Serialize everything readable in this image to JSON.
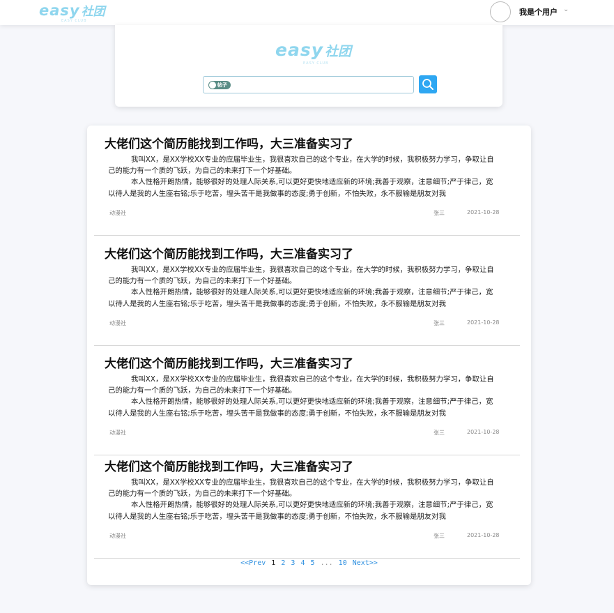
{
  "brand": {
    "logo_main": "easy",
    "logo_sub": "社团",
    "logo_tagline": "EASY CLUB"
  },
  "header": {
    "username": "我是个用户",
    "caret": "⌄"
  },
  "search": {
    "toggle_label": "帖子",
    "placeholder": ""
  },
  "posts": [
    {
      "title": "大佬们这个简历能找到工作吗，大三准备实习了",
      "body": [
        "我叫XX，是XX学校XX专业的应届毕业生，我很喜欢自己的这个专业，在大学的时候，我积极努力学习，争取让自己的能力有一个质的飞跃，为自己的未来打下一个好基础。",
        "本人性格开朗热情，能够很好的处理人际关系,可以更好更快地适应新的环境;我善于观察，注意细节;严于律己，宽以待人是我的人生座右铭;乐于吃苦，埋头苦干是我做事的态度;勇于创新，不怕失败，永不服输是朋友对我"
      ],
      "club": "动漫社",
      "author": "张三",
      "date": "2021-10-28"
    },
    {
      "title": "大佬们这个简历能找到工作吗，大三准备实习了",
      "body": [
        "我叫XX，是XX学校XX专业的应届毕业生，我很喜欢自己的这个专业，在大学的时候，我积极努力学习，争取让自己的能力有一个质的飞跃，为自己的未来打下一个好基础。",
        "本人性格开朗热情，能够很好的处理人际关系,可以更好更快地适应新的环境;我善于观察，注意细节;严于律己，宽以待人是我的人生座右铭;乐于吃苦，埋头苦干是我做事的态度;勇于创新，不怕失败，永不服输是朋友对我"
      ],
      "club": "动漫社",
      "author": "张三",
      "date": "2021-10-28"
    },
    {
      "title": "大佬们这个简历能找到工作吗，大三准备实习了",
      "body": [
        "我叫XX，是XX学校XX专业的应届毕业生，我很喜欢自己的这个专业，在大学的时候，我积极努力学习，争取让自己的能力有一个质的飞跃，为自己的未来打下一个好基础。",
        "本人性格开朗热情，能够很好的处理人际关系,可以更好更快地适应新的环境;我善于观察，注意细节;严于律己，宽以待人是我的人生座右铭;乐于吃苦，埋头苦干是我做事的态度;勇于创新，不怕失败，永不服输是朋友对我"
      ],
      "club": "动漫社",
      "author": "张三",
      "date": "2021-10-28"
    },
    {
      "title": "大佬们这个简历能找到工作吗，大三准备实习了",
      "body": [
        "我叫XX，是XX学校XX专业的应届毕业生，我很喜欢自己的这个专业，在大学的时候，我积极努力学习，争取让自己的能力有一个质的飞跃，为自己的未来打下一个好基础。",
        "本人性格开朗热情，能够很好的处理人际关系,可以更好更快地适应新的环境;我善于观察，注意细节;严于律己，宽以待人是我的人生座右铭;乐于吃苦，埋头苦干是我做事的态度;勇于创新，不怕失败，永不服输是朋友对我"
      ],
      "club": "动漫社",
      "author": "张三",
      "date": "2021-10-28"
    }
  ],
  "pagination": {
    "prev": "<<Prev",
    "current": "1",
    "pages": [
      "2",
      "3",
      "4",
      "5"
    ],
    "ellipsis": "...",
    "last": "10",
    "next": "Next>>"
  },
  "colors": {
    "accent": "#2ea7f2",
    "logo": "#8fd6ee",
    "toggle": "#5a8d86",
    "background": "#f6f7fb"
  },
  "icons": {
    "search_button": "search-icon",
    "user_caret": "chevron-down-icon"
  }
}
